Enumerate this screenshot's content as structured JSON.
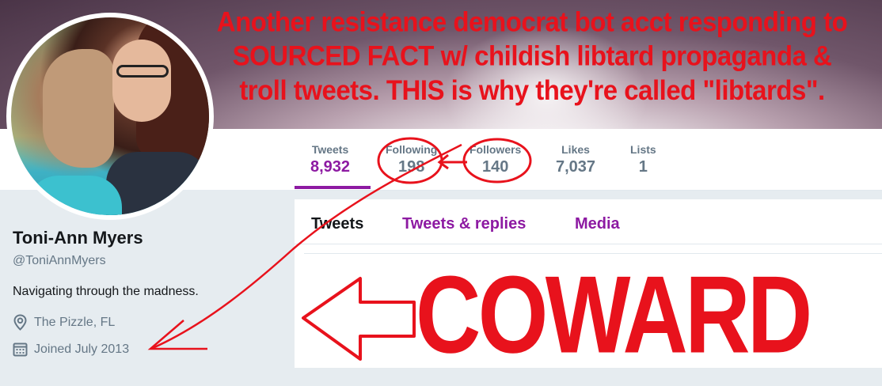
{
  "banner": {
    "lines": [
      "Another resistance democrat bot acct responding to",
      "SOURCED FACT w/ childish libtard propaganda &",
      "troll tweets. THIS is why they're called \"libtards\"."
    ]
  },
  "stats": [
    {
      "label": "Tweets",
      "value": "8,932"
    },
    {
      "label": "Following",
      "value": "198"
    },
    {
      "label": "Followers",
      "value": "140"
    },
    {
      "label": "Likes",
      "value": "7,037"
    },
    {
      "label": "Lists",
      "value": "1"
    }
  ],
  "profile": {
    "name": "Toni-Ann Myers",
    "handle": "@ToniAnnMyers",
    "bio": "Navigating through the madness.",
    "location": "The Pizzle, FL",
    "joined": "Joined July 2013"
  },
  "tabs": [
    "Tweets",
    "Tweets & replies",
    "Media"
  ],
  "annotation": {
    "caption": "COWARD",
    "color": "#e8121c"
  },
  "colors": {
    "accent": "#8d1aa2",
    "muted": "#657786",
    "text": "#14171a"
  },
  "icons": {
    "location": "map-pin-icon",
    "joined": "calendar-icon"
  }
}
